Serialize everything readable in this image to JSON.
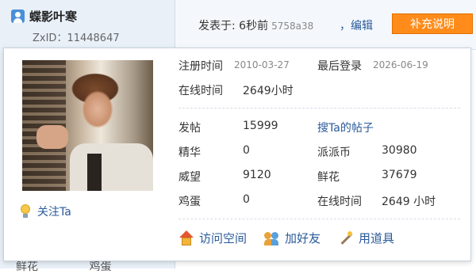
{
  "post": {
    "author": "蝶影叶寒",
    "zxid_label": "ZxID：",
    "zxid_value": "11448647",
    "posted_prefix": "发表于: 6秒前",
    "posted_hash": "5758a38",
    "edit_label": "，编辑",
    "supplement_label": "补充说明"
  },
  "bottom": {
    "item1": "鲜花",
    "item2": "鸡蛋"
  },
  "profile": {
    "follow_label": "关注Ta",
    "register_label": "注册时间",
    "register_value": "2010-03-27",
    "last_login_label": "最后登录",
    "last_login_value": "2026-06-19",
    "online_label": "在线时间",
    "online_value": "2649小时",
    "stats": {
      "posts_label": "发帖",
      "posts_value": "15999",
      "search_posts_label": "搜Ta的帖子",
      "digest_label": "精华",
      "digest_value": "0",
      "paipai_label": "派派币",
      "paipai_value": "30980",
      "prestige_label": "威望",
      "prestige_value": "9120",
      "flowers_label": "鲜花",
      "flowers_value": "37679",
      "eggs_label": "鸡蛋",
      "eggs_value": "0",
      "online2_label": "在线时间",
      "online2_value": "2649 小时"
    },
    "actions": {
      "visit_space": "访问空间",
      "add_friend": "加好友",
      "use_item": "用道具"
    }
  },
  "icons": {
    "user": "user-icon",
    "follow": "bulb-icon",
    "visit": "home-icon",
    "friend": "friends-icon",
    "item": "wand-icon"
  }
}
